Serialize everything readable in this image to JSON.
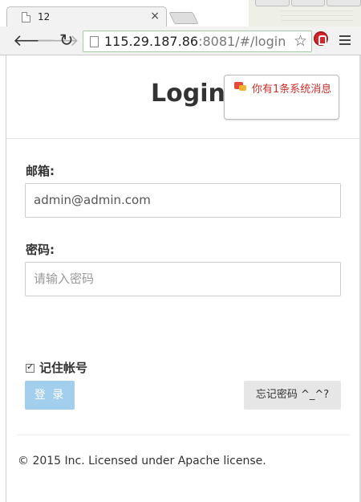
{
  "browser": {
    "tab_title": "12",
    "tab_close": "×",
    "url_host": "115.29.187.86",
    "url_rest": ":8081/#/login",
    "icons": [
      "back-icon",
      "forward-icon",
      "reload-icon",
      "page-icon",
      "star-icon",
      "extension-icon",
      "menu-icon"
    ]
  },
  "header": {
    "title": "Login",
    "message_button": "你有1条系统消息"
  },
  "form": {
    "email_label": "邮箱:",
    "email_value": "admin@admin.com",
    "password_label": "密码:",
    "password_placeholder": "请输入密码",
    "remember_label": "记住帐号",
    "login_button": "登 录",
    "forgot_button": "忘记密码 ^_^?"
  },
  "footer": {
    "text": "© 2015 Inc. Licensed under Apache license."
  },
  "colors": {
    "login_button_bg": "#a3cfef",
    "message_text": "#c9302c"
  }
}
